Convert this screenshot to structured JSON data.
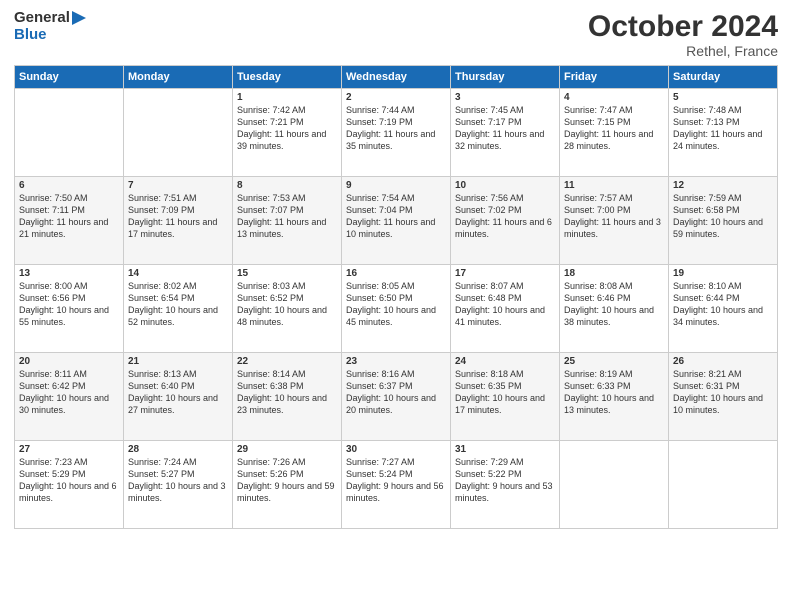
{
  "header": {
    "logo_general": "General",
    "logo_blue": "Blue",
    "month": "October 2024",
    "location": "Rethel, France"
  },
  "days_of_week": [
    "Sunday",
    "Monday",
    "Tuesday",
    "Wednesday",
    "Thursday",
    "Friday",
    "Saturday"
  ],
  "weeks": [
    [
      {
        "day": "",
        "content": ""
      },
      {
        "day": "",
        "content": ""
      },
      {
        "day": "1",
        "content": "Sunrise: 7:42 AM\nSunset: 7:21 PM\nDaylight: 11 hours and 39 minutes."
      },
      {
        "day": "2",
        "content": "Sunrise: 7:44 AM\nSunset: 7:19 PM\nDaylight: 11 hours and 35 minutes."
      },
      {
        "day": "3",
        "content": "Sunrise: 7:45 AM\nSunset: 7:17 PM\nDaylight: 11 hours and 32 minutes."
      },
      {
        "day": "4",
        "content": "Sunrise: 7:47 AM\nSunset: 7:15 PM\nDaylight: 11 hours and 28 minutes."
      },
      {
        "day": "5",
        "content": "Sunrise: 7:48 AM\nSunset: 7:13 PM\nDaylight: 11 hours and 24 minutes."
      }
    ],
    [
      {
        "day": "6",
        "content": "Sunrise: 7:50 AM\nSunset: 7:11 PM\nDaylight: 11 hours and 21 minutes."
      },
      {
        "day": "7",
        "content": "Sunrise: 7:51 AM\nSunset: 7:09 PM\nDaylight: 11 hours and 17 minutes."
      },
      {
        "day": "8",
        "content": "Sunrise: 7:53 AM\nSunset: 7:07 PM\nDaylight: 11 hours and 13 minutes."
      },
      {
        "day": "9",
        "content": "Sunrise: 7:54 AM\nSunset: 7:04 PM\nDaylight: 11 hours and 10 minutes."
      },
      {
        "day": "10",
        "content": "Sunrise: 7:56 AM\nSunset: 7:02 PM\nDaylight: 11 hours and 6 minutes."
      },
      {
        "day": "11",
        "content": "Sunrise: 7:57 AM\nSunset: 7:00 PM\nDaylight: 11 hours and 3 minutes."
      },
      {
        "day": "12",
        "content": "Sunrise: 7:59 AM\nSunset: 6:58 PM\nDaylight: 10 hours and 59 minutes."
      }
    ],
    [
      {
        "day": "13",
        "content": "Sunrise: 8:00 AM\nSunset: 6:56 PM\nDaylight: 10 hours and 55 minutes."
      },
      {
        "day": "14",
        "content": "Sunrise: 8:02 AM\nSunset: 6:54 PM\nDaylight: 10 hours and 52 minutes."
      },
      {
        "day": "15",
        "content": "Sunrise: 8:03 AM\nSunset: 6:52 PM\nDaylight: 10 hours and 48 minutes."
      },
      {
        "day": "16",
        "content": "Sunrise: 8:05 AM\nSunset: 6:50 PM\nDaylight: 10 hours and 45 minutes."
      },
      {
        "day": "17",
        "content": "Sunrise: 8:07 AM\nSunset: 6:48 PM\nDaylight: 10 hours and 41 minutes."
      },
      {
        "day": "18",
        "content": "Sunrise: 8:08 AM\nSunset: 6:46 PM\nDaylight: 10 hours and 38 minutes."
      },
      {
        "day": "19",
        "content": "Sunrise: 8:10 AM\nSunset: 6:44 PM\nDaylight: 10 hours and 34 minutes."
      }
    ],
    [
      {
        "day": "20",
        "content": "Sunrise: 8:11 AM\nSunset: 6:42 PM\nDaylight: 10 hours and 30 minutes."
      },
      {
        "day": "21",
        "content": "Sunrise: 8:13 AM\nSunset: 6:40 PM\nDaylight: 10 hours and 27 minutes."
      },
      {
        "day": "22",
        "content": "Sunrise: 8:14 AM\nSunset: 6:38 PM\nDaylight: 10 hours and 23 minutes."
      },
      {
        "day": "23",
        "content": "Sunrise: 8:16 AM\nSunset: 6:37 PM\nDaylight: 10 hours and 20 minutes."
      },
      {
        "day": "24",
        "content": "Sunrise: 8:18 AM\nSunset: 6:35 PM\nDaylight: 10 hours and 17 minutes."
      },
      {
        "day": "25",
        "content": "Sunrise: 8:19 AM\nSunset: 6:33 PM\nDaylight: 10 hours and 13 minutes."
      },
      {
        "day": "26",
        "content": "Sunrise: 8:21 AM\nSunset: 6:31 PM\nDaylight: 10 hours and 10 minutes."
      }
    ],
    [
      {
        "day": "27",
        "content": "Sunrise: 7:23 AM\nSunset: 5:29 PM\nDaylight: 10 hours and 6 minutes."
      },
      {
        "day": "28",
        "content": "Sunrise: 7:24 AM\nSunset: 5:27 PM\nDaylight: 10 hours and 3 minutes."
      },
      {
        "day": "29",
        "content": "Sunrise: 7:26 AM\nSunset: 5:26 PM\nDaylight: 9 hours and 59 minutes."
      },
      {
        "day": "30",
        "content": "Sunrise: 7:27 AM\nSunset: 5:24 PM\nDaylight: 9 hours and 56 minutes."
      },
      {
        "day": "31",
        "content": "Sunrise: 7:29 AM\nSunset: 5:22 PM\nDaylight: 9 hours and 53 minutes."
      },
      {
        "day": "",
        "content": ""
      },
      {
        "day": "",
        "content": ""
      }
    ]
  ]
}
